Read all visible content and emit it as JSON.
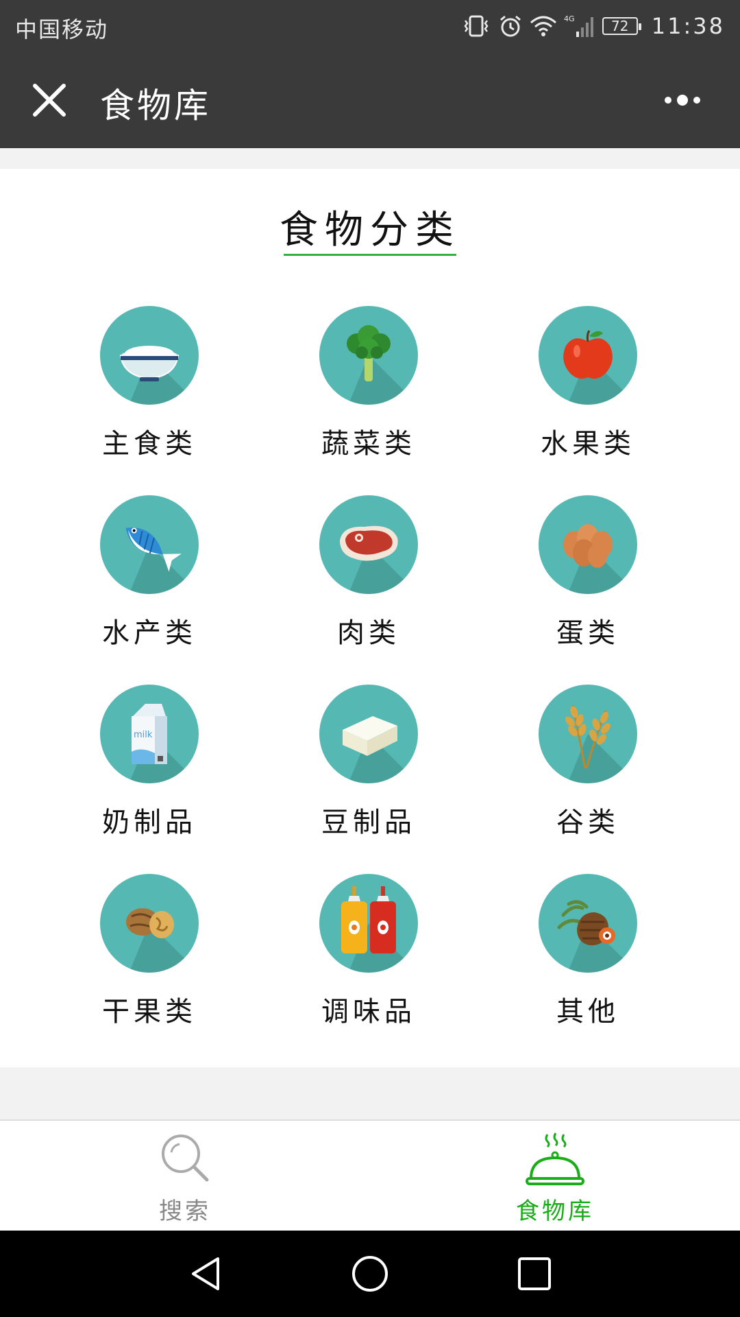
{
  "status_bar": {
    "carrier": "中国移动",
    "network": "4G",
    "battery": "72",
    "time": "11:38"
  },
  "app_bar": {
    "title": "食物库",
    "close_icon": "close-icon",
    "more_icon": "more-icon"
  },
  "section": {
    "title": "食物分类",
    "accent_color": "#2fb53c"
  },
  "categories": [
    {
      "label": "主食类",
      "icon": "rice-bowl-icon"
    },
    {
      "label": "蔬菜类",
      "icon": "broccoli-icon"
    },
    {
      "label": "水果类",
      "icon": "apple-icon"
    },
    {
      "label": "水产类",
      "icon": "fish-icon"
    },
    {
      "label": "肉类",
      "icon": "steak-icon"
    },
    {
      "label": "蛋类",
      "icon": "eggs-icon"
    },
    {
      "label": "奶制品",
      "icon": "milk-carton-icon"
    },
    {
      "label": "豆制品",
      "icon": "tofu-icon"
    },
    {
      "label": "谷类",
      "icon": "wheat-icon"
    },
    {
      "label": "干果类",
      "icon": "walnut-icon"
    },
    {
      "label": "调味品",
      "icon": "condiment-bottles-icon"
    },
    {
      "label": "其他",
      "icon": "others-icon"
    }
  ],
  "tab_bar": {
    "tabs": [
      {
        "label": "搜索",
        "icon": "search-icon",
        "active": false
      },
      {
        "label": "食物库",
        "icon": "food-cloche-icon",
        "active": true
      }
    ],
    "active_color": "#1aad19",
    "inactive_color": "#888888"
  },
  "nav_bar": {
    "buttons": [
      "back-icon",
      "home-icon",
      "recents-icon"
    ]
  }
}
